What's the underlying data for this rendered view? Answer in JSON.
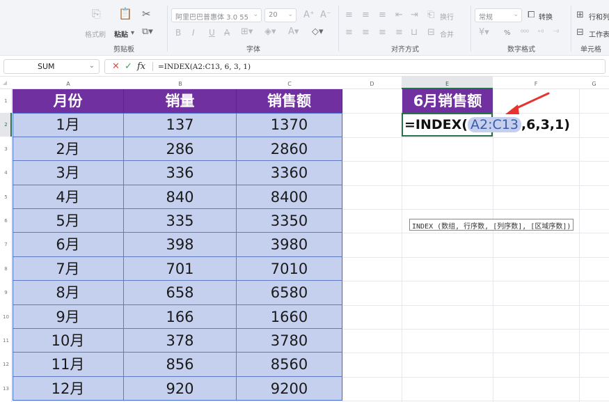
{
  "ribbon": {
    "clipboard": {
      "label": "剪贴板",
      "format_painter": "格式刷",
      "paste": "粘贴"
    },
    "font": {
      "label": "字体",
      "font_name": "阿里巴巴普惠体 3.0 55",
      "font_size": "20",
      "bold": "B",
      "italic": "I",
      "underline": "U"
    },
    "alignment": {
      "label": "对齐方式",
      "wrap": "换行",
      "merge": "合并"
    },
    "number": {
      "label": "数字格式",
      "format": "常规",
      "convert": "转换",
      "percent": "%"
    },
    "cells": {
      "label": "单元格",
      "rows_cols": "行和列",
      "worksheet": "工作表"
    }
  },
  "formula_bar": {
    "name_box": "SUM",
    "fx": "fx",
    "formula": "=INDEX(A2:C13, 6, 3, 1)"
  },
  "sheet": {
    "columns": [
      "A",
      "B",
      "C",
      "D",
      "E",
      "F",
      "G"
    ],
    "rows": [
      "1",
      "2",
      "3",
      "4",
      "5",
      "6",
      "7",
      "8",
      "9",
      "10",
      "11",
      "12",
      "13"
    ],
    "headers": [
      "月份",
      "销量",
      "销售额"
    ],
    "data": [
      [
        "1月",
        "137",
        "1370"
      ],
      [
        "2月",
        "286",
        "2860"
      ],
      [
        "3月",
        "336",
        "3360"
      ],
      [
        "4月",
        "840",
        "8400"
      ],
      [
        "5月",
        "335",
        "3350"
      ],
      [
        "6月",
        "398",
        "3980"
      ],
      [
        "7月",
        "701",
        "7010"
      ],
      [
        "8月",
        "658",
        "6580"
      ],
      [
        "9月",
        "166",
        "1660"
      ],
      [
        "10月",
        "378",
        "3780"
      ],
      [
        "11月",
        "856",
        "8560"
      ],
      [
        "12月",
        "920",
        "9200"
      ]
    ],
    "e1_title": "6月销售额",
    "e2_formula_prefix": "=INDEX(",
    "e2_formula_ref": "A2:C13",
    "e2_formula_suffix": ",6,3,1)",
    "tooltip": "INDEX (数组, 行序数, [列序数], [区域序数])"
  },
  "colors": {
    "header_purple": "#7030a0",
    "data_fill": "#c5d0ee",
    "arrow_red": "#e8322f",
    "active_green": "#217346"
  }
}
